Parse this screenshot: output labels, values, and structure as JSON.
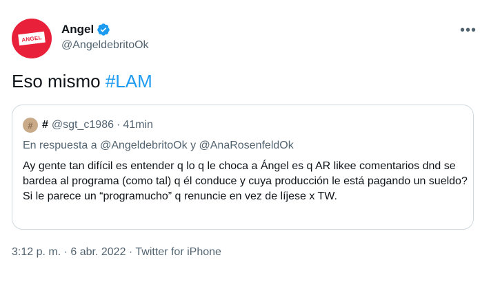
{
  "author": {
    "display_name": "Angel",
    "handle": "@AngeldebritoOk",
    "avatar_text": "ANGEL",
    "verified_icon": "verified-badge-icon"
  },
  "more_menu_icon": "more-horizontal-icon",
  "tweet": {
    "text": "Eso mismo",
    "hashtag": "#LAM"
  },
  "quoted": {
    "name": "#",
    "handle": "@sgt_c1986",
    "separator": "·",
    "time": "41min",
    "reply_prefix": "En respuesta a",
    "reply_mention_1": "@AngeldebritoOk",
    "reply_joiner": "y",
    "reply_mention_2": "@AnaRosenfeldOk",
    "body": "Ay gente tan difícil es entender q lo q le choca a Ángel es q AR likee comentarios dnd se bardea al programa (como tal) q él conduce y cuya producción le está pagando un sueldo? Si le parece un “programucho” q renuncie en vez de líjese x TW."
  },
  "meta": {
    "time": "3:12 p. m.",
    "sep1": "·",
    "date": "6 abr. 2022",
    "sep2": "·",
    "source": "Twitter for iPhone"
  },
  "colors": {
    "accent": "#1d9bf0",
    "secondary_text": "#536471",
    "avatar_bg": "#e8203a"
  }
}
